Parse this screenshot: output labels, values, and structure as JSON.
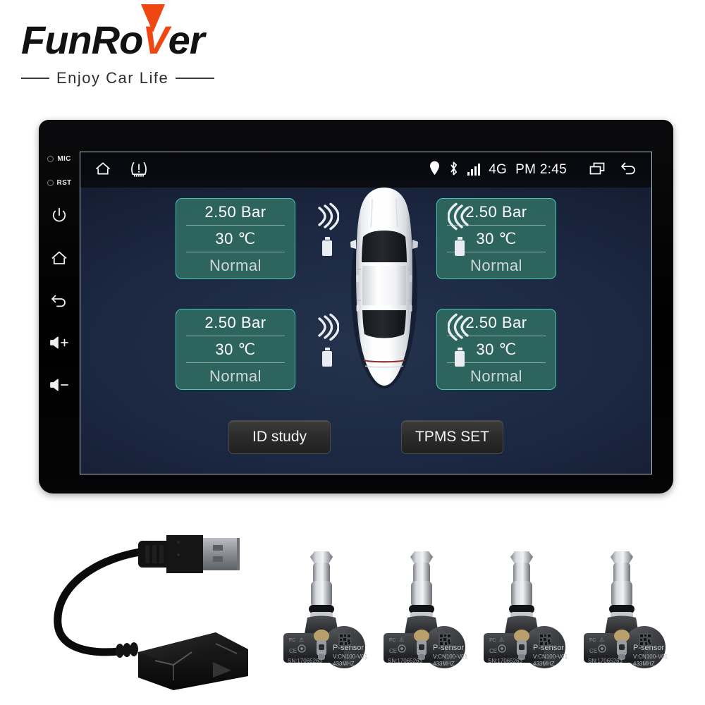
{
  "brand": {
    "name_part1": "FunRo",
    "name_v": "V",
    "name_part2": "er",
    "tagline": "Enjoy Car Life",
    "accent_color": "#ef4612",
    "text_color": "#121212"
  },
  "device": {
    "left_rail": [
      {
        "name": "mic-indicator",
        "label": "MIC",
        "type": "led"
      },
      {
        "name": "reset-indicator",
        "label": "RST",
        "type": "led"
      },
      {
        "name": "power-button",
        "icon": "power-icon"
      },
      {
        "name": "home-button",
        "icon": "home-icon"
      },
      {
        "name": "back-button",
        "icon": "back-arrow-icon"
      },
      {
        "name": "volume-up-button",
        "icon": "volume-up-icon"
      },
      {
        "name": "volume-down-button",
        "icon": "volume-down-icon"
      }
    ]
  },
  "statusbar": {
    "home_icon": "home-icon",
    "tpms_icon": "tpms-warning-icon",
    "location_icon": "location-pin-icon",
    "bluetooth_icon": "bluetooth-icon",
    "signal_icon": "signal-bars-icon",
    "network": "4G",
    "clock": "PM 2:45",
    "recents_icon": "recents-icon",
    "back_icon": "back-arrow-icon"
  },
  "tpms": {
    "panel_bg": "#2f6a61",
    "panel_border": "#49c9b4",
    "tires": [
      {
        "position": "front-left",
        "pressure": "2.50  Bar",
        "temperature": "30  ℃",
        "status": "Normal"
      },
      {
        "position": "front-right",
        "pressure": "2.50  Bar",
        "temperature": "30  ℃",
        "status": "Normal"
      },
      {
        "position": "rear-left",
        "pressure": "2.50  Bar",
        "temperature": "30  ℃",
        "status": "Normal"
      },
      {
        "position": "rear-right",
        "pressure": "2.50  Bar",
        "temperature": "30  ℃",
        "status": "Normal"
      }
    ],
    "buttons": {
      "id_study": "ID study",
      "tpms_set": "TPMS SET"
    }
  },
  "accessories": {
    "receiver": {
      "name": "usb-receiver-module"
    },
    "sensor_labels": {
      "product": "P-sensor",
      "version": "V:CN100-V01",
      "frequency": "433MHZ",
      "serial": "SN:17065263",
      "marks": "FC CE"
    },
    "sensors": [
      {
        "index": 1
      },
      {
        "index": 2
      },
      {
        "index": 3
      },
      {
        "index": 4
      }
    ]
  }
}
